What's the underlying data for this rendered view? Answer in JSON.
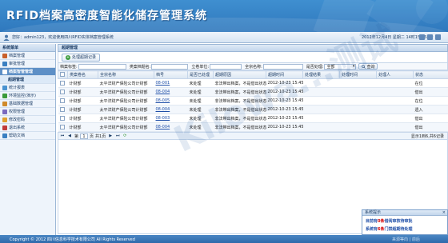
{
  "app": {
    "title": "RFID档案高密度智能化储存管理系统"
  },
  "userbar": {
    "welcome": "您好：admin123，欢迎使用四川RFID实体档案管理系统",
    "date": "2012年12月4日 星期二 14时15分58秒"
  },
  "sidebar": {
    "heading": "系统菜单",
    "items": [
      {
        "label": "档案管理",
        "color": "#c9602a"
      },
      {
        "label": "审批管理",
        "color": "#3a7fc1"
      },
      {
        "label": "档案智管管理",
        "color": "#3d6fb0",
        "active": true
      },
      {
        "label": "超期管理",
        "sub": true,
        "selected": true
      },
      {
        "label": "统计报表",
        "color": "#4a93d0"
      },
      {
        "label": "环境监控(演示)",
        "color": "#3a9a3a"
      },
      {
        "label": "基础数据管理",
        "color": "#d08a2a"
      },
      {
        "label": "权限管理",
        "color": "#7a6ac0"
      },
      {
        "label": "修改密码",
        "color": "#e0a030"
      },
      {
        "label": "退出系统",
        "color": "#c03a3a"
      },
      {
        "label": "帮助文档",
        "color": "#3a7fc1"
      }
    ]
  },
  "main": {
    "title": "超期管理",
    "add_button": "处理超期记录",
    "filters": {
      "archive_label": "档案标签:",
      "category_label": "类案档题名:",
      "issuer_label": "立卷单位:",
      "full_name_label": "全宗名称:",
      "processed_label": "是否处理:",
      "processed_value": "全部",
      "search_button": "查询"
    },
    "columns": [
      "",
      "类案卷名",
      "全宗名称",
      "档号",
      "是否已处理",
      "超期原因",
      "超期时间",
      "处理结果",
      "处理时间",
      "处理人",
      "状态"
    ],
    "rows": [
      {
        "name": "计财部",
        "fonds": "太平洋财产保险公司计财部",
        "code": "08-001",
        "processed": "未处理",
        "reason": "非法带出档案，不是借出状态",
        "time": "2012-10-23 15:45:57",
        "status": "在位"
      },
      {
        "name": "计财部",
        "fonds": "太平洋财产保险公司计财部",
        "code": "08-004",
        "processed": "未处理",
        "reason": "非法带出档案，不是借出状态",
        "time": "2012-10-23 15:45:57",
        "status": "借出"
      },
      {
        "name": "计财部",
        "fonds": "太平洋财产保险公司计财部",
        "code": "08-005",
        "processed": "未处理",
        "reason": "非法带出档案，不是借出状态",
        "time": "2012-10-23 15:45:57",
        "status": "在位"
      },
      {
        "name": "计财部",
        "fonds": "太平洋财产保险公司计财部",
        "code": "08-004",
        "processed": "未处理",
        "reason": "非法带出档案，不是借出状态",
        "time": "2012-10-23 15:45:57",
        "status": "遗入"
      },
      {
        "name": "计财部",
        "fonds": "太平洋财产保险公司计财部",
        "code": "08-003",
        "processed": "未处理",
        "reason": "非法带出档案，不是借出状态",
        "time": "2012-10-23 15:45:42",
        "status": "借出"
      },
      {
        "name": "计财部",
        "fonds": "太平洋财产保险公司计财部",
        "code": "08-004",
        "processed": "未处理",
        "reason": "非法带出档案，不是借出状态",
        "time": "2012-10-23 15:45:42",
        "status": "借出"
      }
    ],
    "pager": {
      "page_prefix": "第",
      "page": "1",
      "page_suffix": "页",
      "total": "共1页",
      "range": "显示1到6,共6记录"
    }
  },
  "footer": {
    "copyright": "Copyright © 2012 四川信息科学技术有限公司 All Rights Reserved",
    "right": "来源等向 | 前后"
  },
  "popup": {
    "title": "系统提示",
    "close": "×",
    "line1_pre": "目前有",
    "line1_count": "0条",
    "line1_post": "借阅审核待审批",
    "line2_pre": "系统有",
    "line2_count": "6条",
    "line2_post": "门禁超期待处理"
  },
  "watermark": "Kilowa...测试"
}
